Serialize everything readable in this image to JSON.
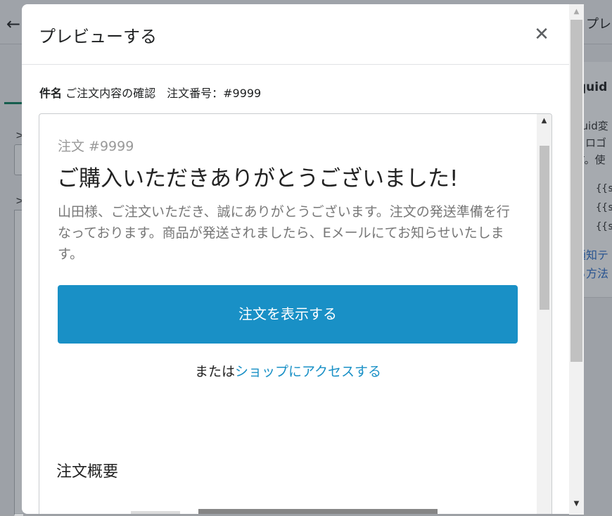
{
  "background": {
    "title_partial": "プレビ",
    "card": {
      "heading_partial": "quid",
      "text_lines": [
        "quid変",
        "とロゴ",
        "す。使"
      ],
      "code_lines": [
        "{{s",
        "{{s",
        "{{s"
      ],
      "link_lines": [
        "通知テ",
        "る方法"
      ]
    }
  },
  "modal": {
    "title": "プレビューする",
    "close_icon": "close-icon",
    "subject": {
      "label": "件名",
      "value": "ご注文内容の確認　注文番号：#9999"
    },
    "email": {
      "order_number": "注文 #9999",
      "heading": "ご購入いただきありがとうございました!",
      "message": "山田様、ご注文いただき、誠にありがとうございます。注文の発送準備を行なっております。商品が発送されましたら、Eメールにてお知らせいたします。",
      "view_order_button": "注文を表示する",
      "or_text": "または",
      "shop_link": "ショップにアクセスする",
      "summary_heading": "注文概要"
    }
  },
  "colors": {
    "accent": "#1990c6",
    "overlay": "#212b36"
  }
}
